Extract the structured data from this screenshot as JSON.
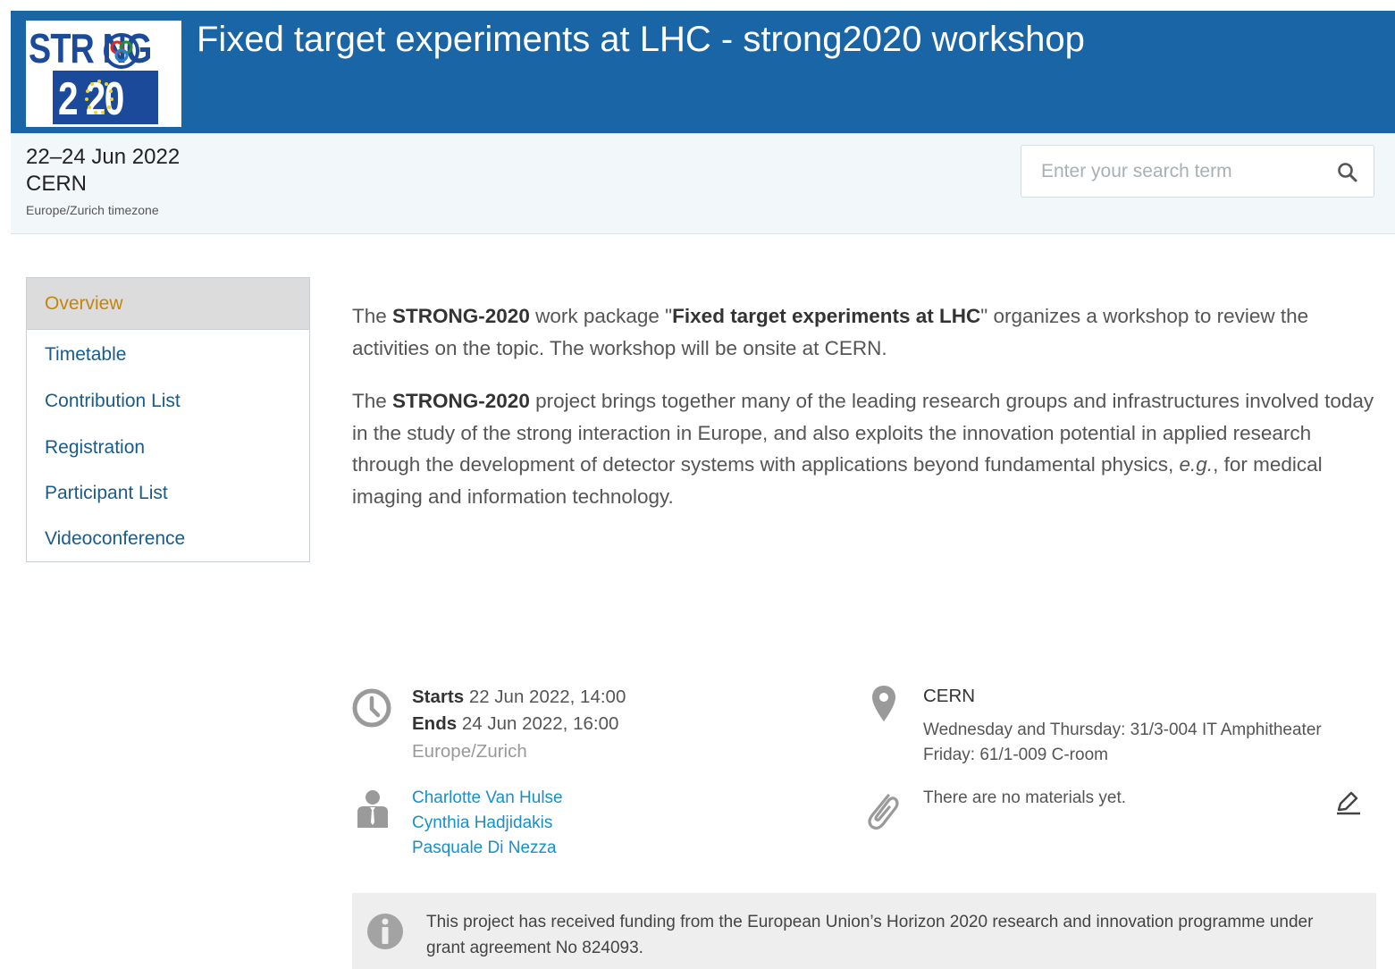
{
  "header": {
    "title": "Fixed target experiments at LHC - strong2020 workshop",
    "logo_top": "STR  NG",
    "logo_bottom": "2  20",
    "bg_color": "#1a65a6"
  },
  "event": {
    "date": "22–24 Jun 2022",
    "venue": "CERN",
    "timezone": "Europe/Zurich timezone"
  },
  "search": {
    "placeholder": "Enter your search term",
    "icon": "search-icon"
  },
  "menu": {
    "items": [
      {
        "label": "Overview",
        "active": true
      },
      {
        "label": "Timetable"
      },
      {
        "label": "Contribution List"
      },
      {
        "label": "Registration"
      },
      {
        "label": "Participant List"
      },
      {
        "label": "Videoconference"
      }
    ]
  },
  "description": {
    "p1": {
      "t1": "The ",
      "b1": "STRONG-2020",
      "t2": " work package \"",
      "b2": "Fixed target experiments at LHC",
      "t3": "\" organizes a workshop to review the activities on the topic. The workshop will be onsite at CERN."
    },
    "p2": {
      "t1": "The ",
      "b1": "STRONG-2020",
      "t2": " project brings together many of the leading research groups and infrastructures involved today in the study of the strong interaction in Europe, and also exploits the innovation potential in applied research through the development of detector systems with applications beyond fundamental physics, ",
      "i1": "e.g.",
      "t3": ", for medical imaging and information technology."
    }
  },
  "details": {
    "starts_label": "Starts",
    "starts_value": "22 Jun 2022, 14:00",
    "ends_label": "Ends",
    "ends_value": "24 Jun 2022, 16:00",
    "tz": "Europe/Zurich",
    "location_name": "CERN",
    "location_line1": "Wednesday and Thursday: 31/3-004 IT Amphitheater",
    "location_line2": "Friday: 61/1-009 C-room",
    "chairs": [
      "Charlotte Van Hulse",
      "Cynthia Hadjidakis",
      "Pasquale Di Nezza"
    ],
    "materials": "There are no materials yet."
  },
  "notice": {
    "text": "This project has received funding from the European Union’s Horizon 2020 research and innovation programme under grant agreement No 824093."
  }
}
